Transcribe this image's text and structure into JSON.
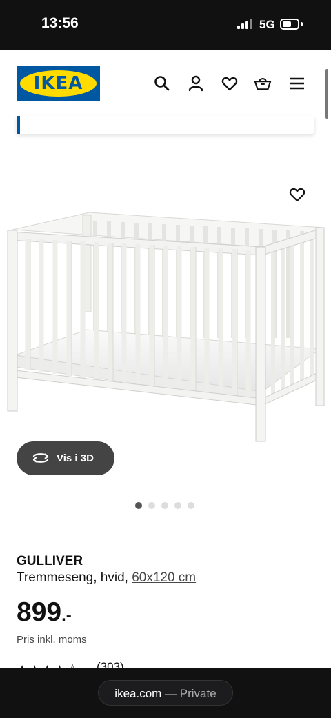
{
  "status_bar": {
    "time": "13:56",
    "network": "5G"
  },
  "header": {
    "logo_text": "IKEA",
    "icons": [
      "search-icon",
      "user-icon",
      "heart-icon",
      "basket-icon",
      "menu-icon"
    ]
  },
  "gallery": {
    "three_d_label": "Vis i 3D",
    "image_count": 5,
    "active_index": 0
  },
  "product": {
    "name": "GULLIVER",
    "description": "Tremmeseng, hvid, ",
    "size": "60x120 cm",
    "price": "899",
    "price_suffix": ".-",
    "price_note": "Pris inkl. moms",
    "rating_count": "(303)",
    "rating_stars": 4.5
  },
  "browser": {
    "domain": "ikea.com",
    "mode": " — Private"
  },
  "colors": {
    "brand_blue": "#0058a3",
    "brand_yellow": "#ffdb00",
    "button_dark": "#444444"
  }
}
